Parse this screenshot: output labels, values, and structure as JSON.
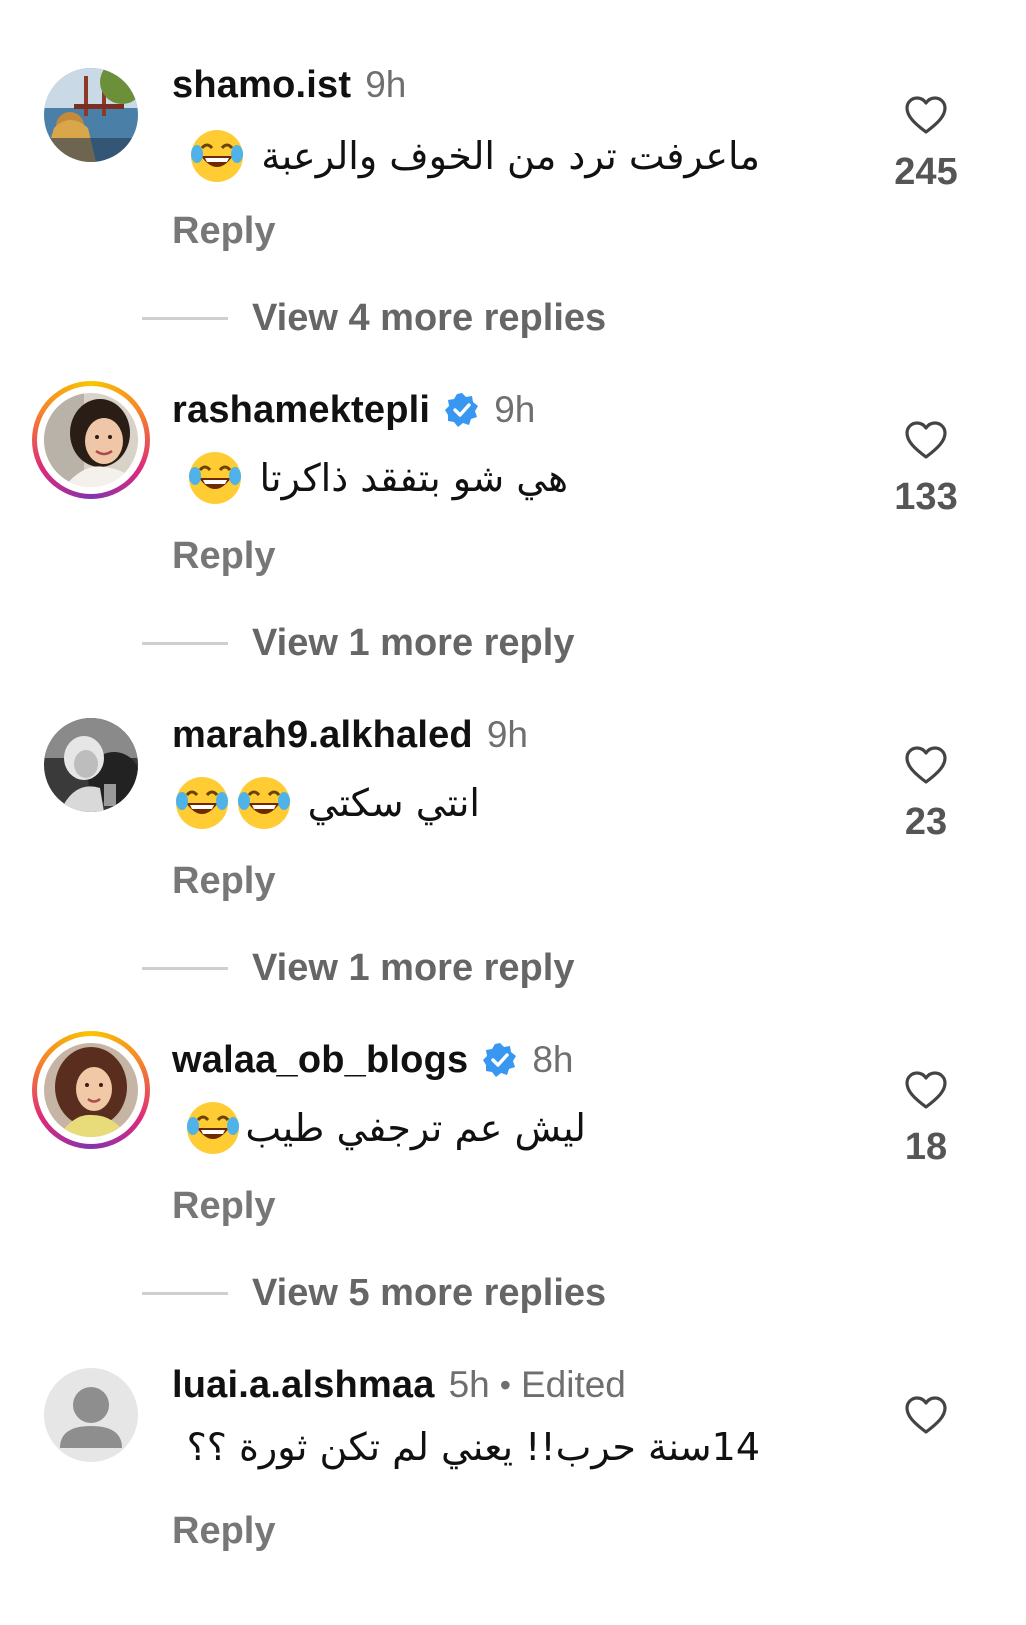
{
  "comments": [
    {
      "username": "shamo.ist",
      "verified": false,
      "time": "9h",
      "text": "ماعرفت ترد من الخوف والرعبة",
      "emoji_count": 1,
      "likes": "245",
      "reply_label": "Reply",
      "view_more": "View 4 more replies",
      "avatar_ring": false
    },
    {
      "username": "rashamektepli",
      "verified": true,
      "time": "9h",
      "text": "هي شو بتفقد ذاكرتا",
      "emoji_count": 1,
      "likes": "133",
      "reply_label": "Reply",
      "view_more": "View 1 more reply",
      "avatar_ring": true
    },
    {
      "username": "marah9.alkhaled",
      "verified": false,
      "time": "9h",
      "text": "انتي سكتي",
      "emoji_count": 2,
      "likes": "23",
      "reply_label": "Reply",
      "view_more": "View 1 more reply",
      "avatar_ring": false
    },
    {
      "username": "walaa_ob_blogs",
      "verified": true,
      "time": "8h",
      "text": "ليش عم ترجفي طيب",
      "emoji_count": 1,
      "likes": "18",
      "reply_label": "Reply",
      "view_more": "View 5 more replies",
      "avatar_ring": true
    },
    {
      "username": "luai.a.alshmaa",
      "verified": false,
      "time": "5h",
      "edited_separator": "•",
      "edited": "Edited",
      "text": "14سنة حرب!! يعني لم تكن ثورة ؟؟",
      "emoji_count": 0,
      "likes": "",
      "reply_label": "Reply",
      "view_more": "",
      "avatar_ring": false,
      "default_avatar": true
    }
  ],
  "colors": {
    "username": "#111111",
    "meta": "#6f6f6f",
    "reply": "#777777",
    "verified": "#3897f0",
    "divider": "#cfcfcf",
    "heart": "#444444"
  },
  "icons": {
    "like": "heart-outline-icon",
    "verified": "verified-badge-icon",
    "emoji": "face-with-tears-of-joy-emoji",
    "default_avatar": "default-profile-icon"
  }
}
